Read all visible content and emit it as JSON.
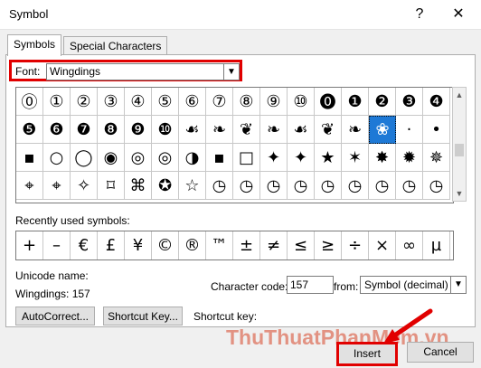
{
  "window": {
    "title": "Symbol",
    "help_glyph": "?",
    "close_glyph": "✕"
  },
  "tabs": [
    {
      "label": "Symbols",
      "active": true
    },
    {
      "label": "Special Characters",
      "active": false
    }
  ],
  "font": {
    "label": "Font:",
    "value": "Wingdings"
  },
  "symbol_grid": [
    [
      "⓪",
      "①",
      "②",
      "③",
      "④",
      "⑤",
      "⑥",
      "⑦",
      "⑧",
      "⑨",
      "⑩",
      "⓿",
      "❶",
      "❷",
      "❸",
      "❹"
    ],
    [
      "❺",
      "❻",
      "❼",
      "❽",
      "❾",
      "❿",
      "☙",
      "❧",
      "❦",
      "❧",
      "☙",
      "❦",
      "❧",
      "❀",
      "·",
      "•"
    ],
    [
      "▪",
      "○",
      "◯",
      "◉",
      "◎",
      "◎",
      "◑",
      "▪",
      "□",
      "✦",
      "✦",
      "★",
      "✶",
      "✸",
      "✹",
      "✵"
    ],
    [
      "⌖",
      "⌖",
      "✧",
      "⌑",
      "⌘",
      "✪",
      "☆",
      "◷",
      "◷",
      "◷",
      "◷",
      "◷",
      "◷",
      "◷",
      "◷",
      "◷"
    ]
  ],
  "selected_symbol": {
    "row": 1,
    "col": 13
  },
  "recent": {
    "label": "Recently used symbols:",
    "symbols": [
      "+",
      "–",
      "€",
      "£",
      "¥",
      "©",
      "®",
      "™",
      "±",
      "≠",
      "≤",
      "≥",
      "÷",
      "×",
      "∞",
      "µ"
    ]
  },
  "unicode": {
    "label": "Unicode name:",
    "value": "Wingdings: 157"
  },
  "char_code": {
    "label": "Character code:",
    "value": "157"
  },
  "from": {
    "label": "from:",
    "value": "Symbol (decimal)"
  },
  "buttons": {
    "autocorrect": "AutoCorrect...",
    "shortcut_key": "Shortcut Key...",
    "insert": "Insert",
    "cancel": "Cancel"
  },
  "shortcut_key_label": "Shortcut key:",
  "watermark": "ThuThuatPhanMem.vn",
  "accent_red": "#e10000",
  "selection_blue": "#1e79d6"
}
